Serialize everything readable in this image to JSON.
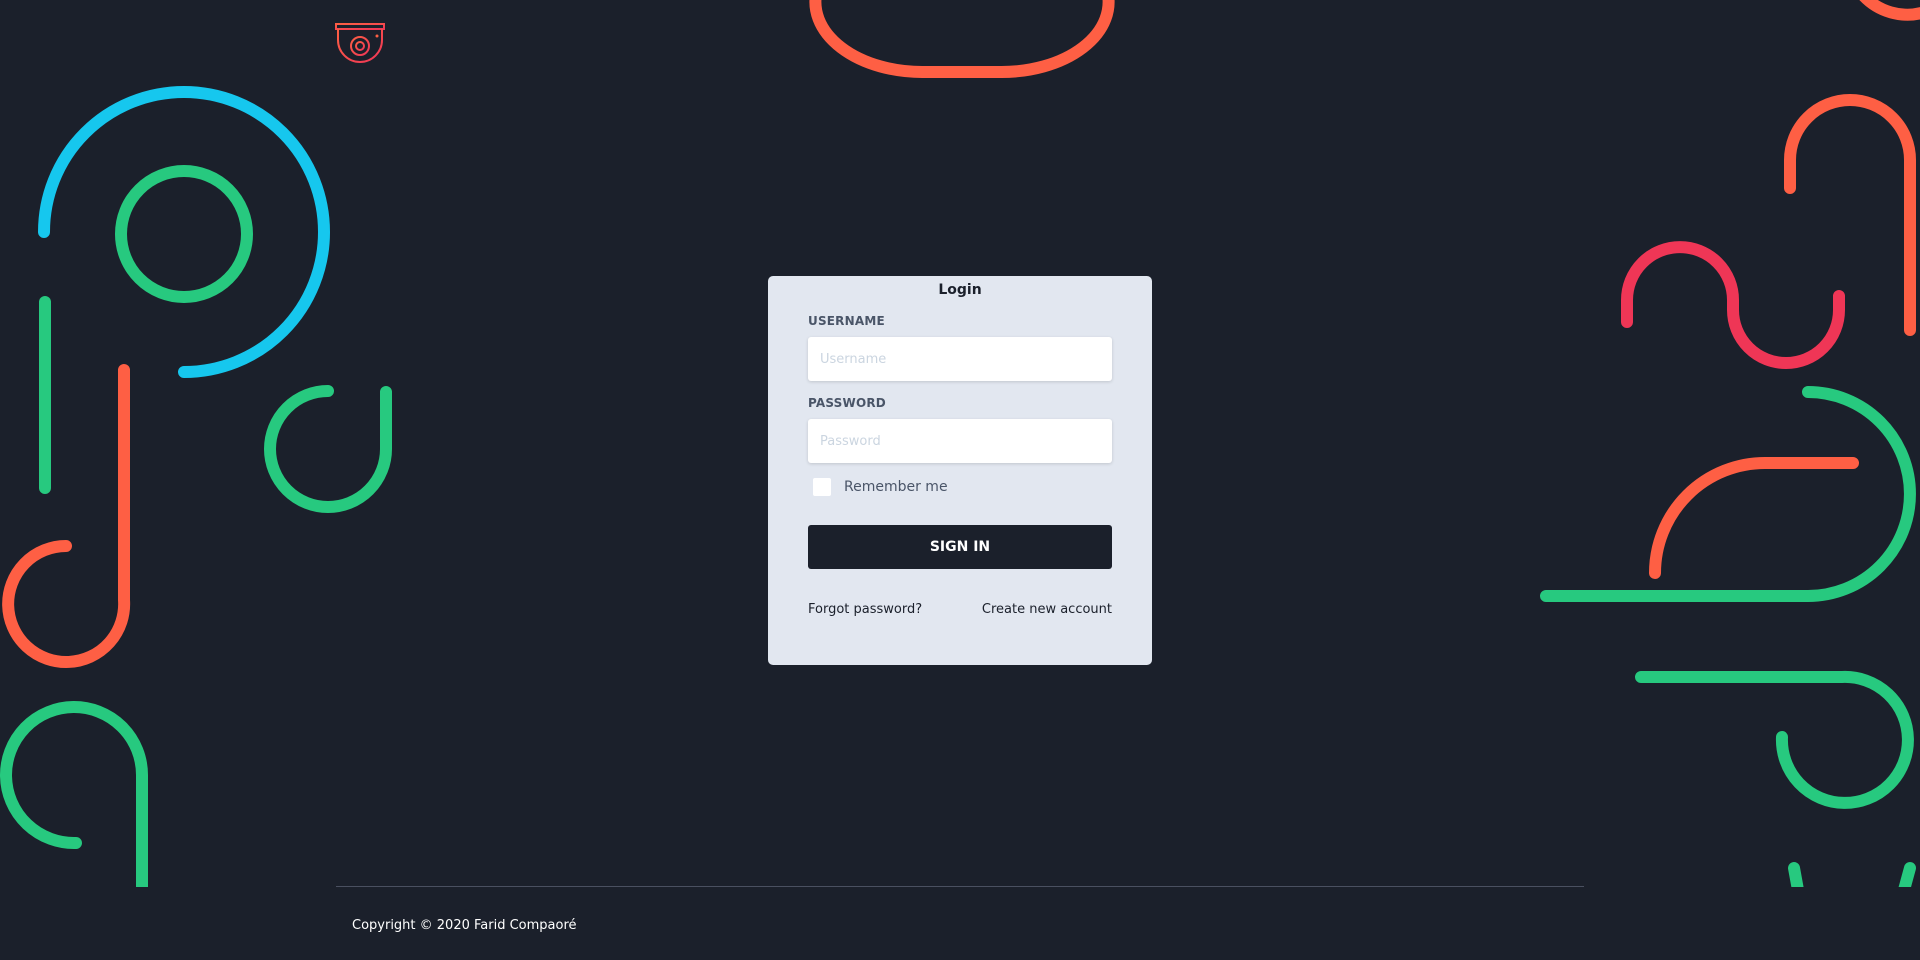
{
  "login": {
    "title": "Login",
    "username_label": "USERNAME",
    "username_placeholder": "Username",
    "username_value": "",
    "password_label": "PASSWORD",
    "password_placeholder": "Password",
    "password_value": "",
    "remember_label": "Remember me",
    "remember_checked": false,
    "signin_label": "SIGN IN",
    "forgot_link": "Forgot password?",
    "create_link": "Create new account"
  },
  "footer": {
    "copyright": "Copyright © 2020 Farid Compaoré"
  },
  "icons": {
    "logo": "security-camera-icon"
  },
  "colors": {
    "background": "#1b202b",
    "card": "#e2e7f0",
    "button": "#1b202b",
    "accent_orange": "#fe5f44",
    "accent_green": "#27c97f",
    "accent_cyan": "#16c7ee",
    "accent_pink": "#ef3656"
  }
}
